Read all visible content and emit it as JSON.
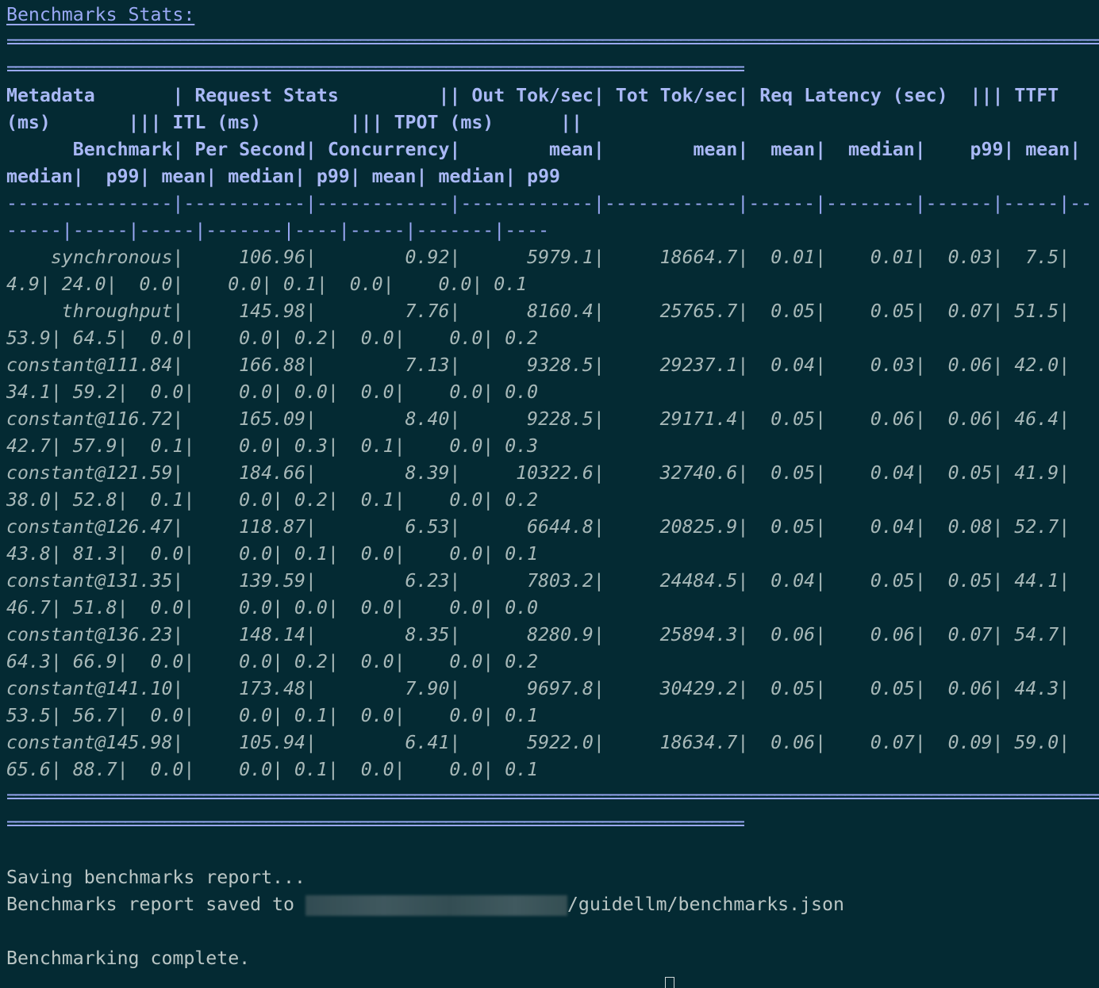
{
  "terminal": {
    "title": "Benchmarks Stats:",
    "separator_long": "==========================================================================================================================================================================================",
    "separator_short": "==============================================================================================",
    "header_lines": [
      "Metadata       | Request Stats         || Out Tok/sec| Tot Tok/sec| Req Latency (sec)  ||| TTFT",
      "(ms)       ||| ITL (ms)        ||| TPOT (ms)      ||",
      "      Benchmark| Per Second| Concurrency|        mean|        mean|  mean|  median|    p99| mean|",
      "median|  p99| mean| median| p99| mean| median| p99"
    ],
    "dash_lines": [
      "---------------|-----------|------------|------------|------------|------|--------|------|-----|--",
      "-----|-----|-----|-------|----|-----|-------|----"
    ],
    "rows": [
      [
        "    synchronous|     106.96|        0.92|      5979.1|     18664.7|  0.01|    0.01|  0.03|  7.5|",
        "4.9| 24.0|  0.0|    0.0| 0.1|  0.0|    0.0| 0.1"
      ],
      [
        "     throughput|     145.98|        7.76|      8160.4|     25765.7|  0.05|    0.05|  0.07| 51.5|",
        "53.9| 64.5|  0.0|    0.0| 0.2|  0.0|    0.0| 0.2"
      ],
      [
        "constant@111.84|     166.88|        7.13|      9328.5|     29237.1|  0.04|    0.03|  0.06| 42.0|",
        "34.1| 59.2|  0.0|    0.0| 0.0|  0.0|    0.0| 0.0"
      ],
      [
        "constant@116.72|     165.09|        8.40|      9228.5|     29171.4|  0.05|    0.06|  0.06| 46.4|",
        "42.7| 57.9|  0.1|    0.0| 0.3|  0.1|    0.0| 0.3"
      ],
      [
        "constant@121.59|     184.66|        8.39|     10322.6|     32740.6|  0.05|    0.04|  0.05| 41.9|",
        "38.0| 52.8|  0.1|    0.0| 0.2|  0.1|    0.0| 0.2"
      ],
      [
        "constant@126.47|     118.87|        6.53|      6644.8|     20825.9|  0.05|    0.04|  0.08| 52.7|",
        "43.8| 81.3|  0.0|    0.0| 0.1|  0.0|    0.0| 0.1"
      ],
      [
        "constant@131.35|     139.59|        6.23|      7803.2|     24484.5|  0.04|    0.05|  0.05| 44.1|",
        "46.7| 51.8|  0.0|    0.0| 0.0|  0.0|    0.0| 0.0"
      ],
      [
        "constant@136.23|     148.14|        8.35|      8280.9|     25894.3|  0.06|    0.06|  0.07| 54.7|",
        "64.3| 66.9|  0.0|    0.0| 0.2|  0.0|    0.0| 0.2"
      ],
      [
        "constant@141.10|     173.48|        7.90|      9697.8|     30429.2|  0.05|    0.05|  0.06| 44.3|",
        "53.5| 56.7|  0.0|    0.0| 0.1|  0.0|    0.0| 0.1"
      ],
      [
        "constant@145.98|     105.94|        6.41|      5922.0|     18634.7|  0.06|    0.07|  0.09| 59.0|",
        "65.6| 88.7|  0.0|    0.0| 0.1|  0.0|    0.0| 0.1"
      ]
    ],
    "saving_line": "Saving benchmarks report...",
    "saved_prefix": "Benchmarks report saved to ",
    "saved_suffix": "/guidellm/benchmarks.json",
    "complete_line": "Benchmarking complete."
  },
  "colors": {
    "background": "#042a33",
    "header": "#a9b8f5",
    "text": "#bac6c5"
  }
}
